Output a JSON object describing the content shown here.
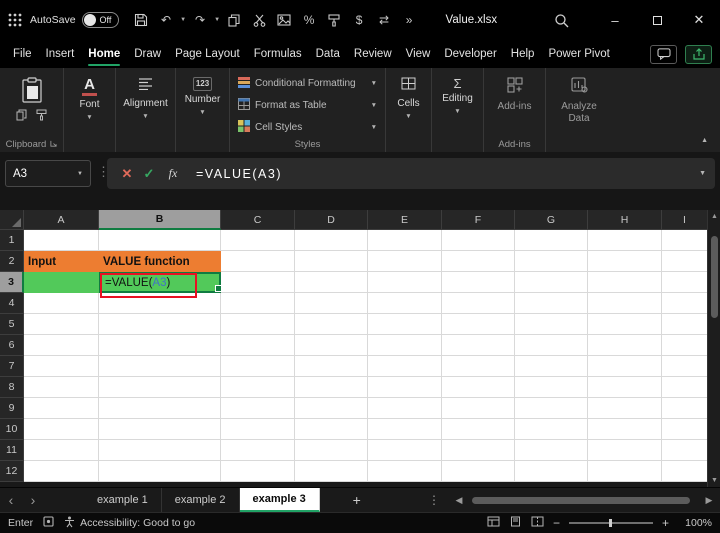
{
  "titlebar": {
    "autosave_label": "AutoSave",
    "autosave_state": "Off",
    "filename": "Value.xlsx"
  },
  "menubar": {
    "tabs": [
      "File",
      "Insert",
      "Home",
      "Draw",
      "Page Layout",
      "Formulas",
      "Data",
      "Review",
      "View",
      "Developer",
      "Help",
      "Power Pivot"
    ],
    "active_tab": "Home"
  },
  "ribbon": {
    "clipboard_group": "Clipboard",
    "font": "Font",
    "alignment": "Alignment",
    "number": "Number",
    "conditional_formatting": "Conditional Formatting",
    "format_as_table": "Format as Table",
    "cell_styles": "Cell Styles",
    "styles_group": "Styles",
    "cells": "Cells",
    "editing": "Editing",
    "addins": "Add-ins",
    "analyze_data": "Analyze Data"
  },
  "formula_bar": {
    "name_box": "A3",
    "formula": "=VALUE(A3)"
  },
  "grid": {
    "columns": [
      "A",
      "B",
      "C",
      "D",
      "E",
      "F",
      "G",
      "H",
      "I"
    ],
    "rows": [
      "1",
      "2",
      "3",
      "4",
      "5",
      "6",
      "7",
      "8",
      "9",
      "10",
      "11",
      "12"
    ],
    "a2": "Input",
    "b2": "VALUE function",
    "b3": {
      "prefix": "=VALUE(",
      "ref": "A3",
      "suffix": ")"
    }
  },
  "sheet_tabs": {
    "tabs": [
      "example 1",
      "example 2",
      "example 3"
    ],
    "active": "example 3",
    "add_label": "+"
  },
  "status_bar": {
    "mode": "Enter",
    "accessibility": "Accessibility: Good to go",
    "zoom": "100%"
  },
  "colors": {
    "accent_green": "#21A366",
    "selection_green": "#107C41",
    "orange_fill": "#ED7D31",
    "green_fill": "#52C95A",
    "reference_blue": "#4472C4",
    "annotation_red": "#E81123"
  }
}
